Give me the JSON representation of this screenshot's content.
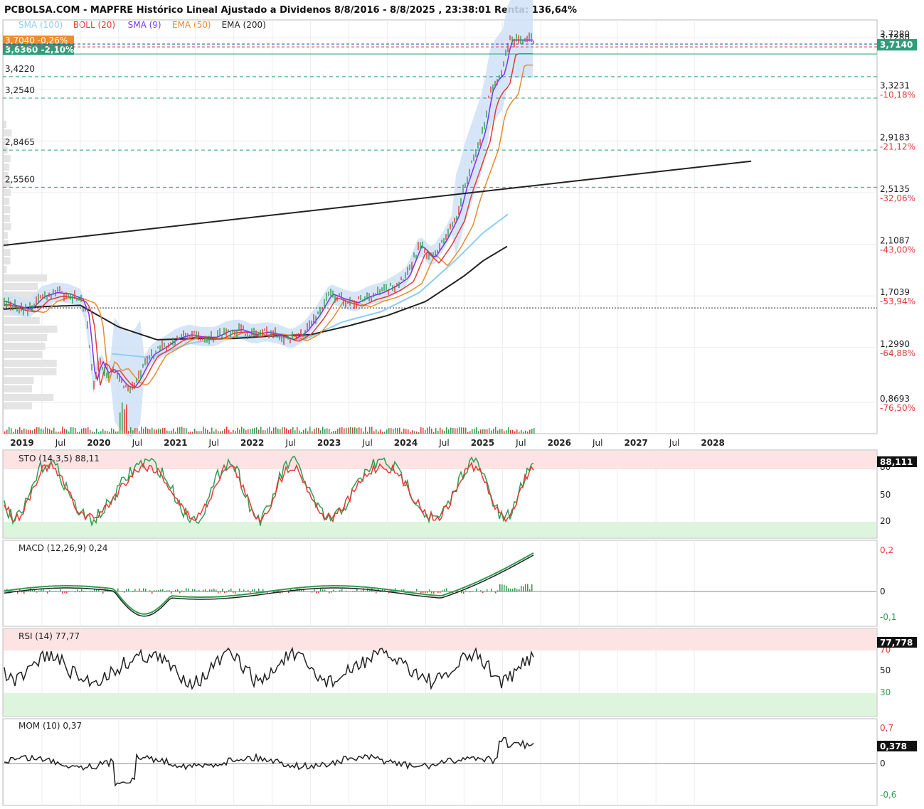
{
  "title": "PCBOLSA.COM - MAPFRE Histórico Lineal Ajustado a Dividenos 8/8/2016 - 8/8/2025 , 23:38:01 Renta: 136,64%",
  "legend": [
    {
      "label": "SMA (100)",
      "color": "#8ecdf0"
    },
    {
      "label": "BOLL (20)",
      "color": "#e53935"
    },
    {
      "label": "SMA (9)",
      "color": "#7b2ff7"
    },
    {
      "label": "EMA (50)",
      "color": "#e8892e"
    },
    {
      "label": "EMA (200)",
      "color": "#222222"
    }
  ],
  "price_tags": {
    "orange": "3,7040 -0,26%",
    "green": "3,6360 -2,10%",
    "last_price": "3,7140",
    "top_axis": "3,7280"
  },
  "colors": {
    "up": "#2e9d4f",
    "down": "#e53935",
    "band": "#cfe2f7",
    "tag_green": "#2e9d7a",
    "tag_orange": "#f28c28"
  },
  "chart_data": [
    {
      "type": "line",
      "panel": "price",
      "x_ticks": [
        "2019",
        "Jul",
        "2020",
        "Jul",
        "2021",
        "Jul",
        "2022",
        "Jul",
        "2023",
        "Jul",
        "2024",
        "Jul",
        "2025",
        "Jul",
        "2026",
        "Jul",
        "2027",
        "Jul",
        "2028"
      ],
      "bold_years": [
        "2019",
        "2020",
        "2021",
        "2022",
        "2023",
        "2024",
        "2025",
        "2026",
        "2027",
        "2028"
      ],
      "y_ticks": [
        {
          "value": 3.728,
          "label": "3,7280",
          "pct": ""
        },
        {
          "value": 3.3231,
          "label": "3,3231",
          "pct": "-10,18%"
        },
        {
          "value": 2.9183,
          "label": "2,9183",
          "pct": "-21,12%"
        },
        {
          "value": 2.5135,
          "label": "2,5135",
          "pct": "-32,06%"
        },
        {
          "value": 2.1087,
          "label": "2,1087",
          "pct": "-43,00%"
        },
        {
          "value": 1.7039,
          "label": "1,7039",
          "pct": "-53,94%"
        },
        {
          "value": 1.299,
          "label": "1,2990",
          "pct": "-64,88%"
        },
        {
          "value": 0.8693,
          "label": "0,8693",
          "pct": "-76,50%"
        }
      ],
      "levels": [
        {
          "value": 3.422,
          "label": "3,4220"
        },
        {
          "value": 3.254,
          "label": "3,2540"
        },
        {
          "value": 2.8465,
          "label": "2,8465"
        },
        {
          "value": 2.556,
          "label": "2,5560"
        }
      ],
      "support_line": 1.61,
      "trendline": [
        {
          "x": "2019-01",
          "y": 2.1
        },
        {
          "x": "2028-01",
          "y": 2.72
        }
      ],
      "series": [
        {
          "name": "Price",
          "color": "#2e9d4f",
          "x": [
            "2019-01",
            "2019-03",
            "2019-05",
            "2019-07",
            "2019-09",
            "2019-11",
            "2020-01",
            "2020-02",
            "2020-03",
            "2020-04",
            "2020-05",
            "2020-06",
            "2020-07",
            "2020-08",
            "2020-09",
            "2020-10",
            "2020-11",
            "2020-12",
            "2021-02",
            "2021-04",
            "2021-06",
            "2021-08",
            "2021-10",
            "2021-12",
            "2022-02",
            "2022-04",
            "2022-06",
            "2022-08",
            "2022-10",
            "2022-12",
            "2023-02",
            "2023-04",
            "2023-06",
            "2023-08",
            "2023-10",
            "2023-12",
            "2024-02",
            "2024-04",
            "2024-06",
            "2024-08",
            "2024-10",
            "2024-12",
            "2025-01",
            "2025-02",
            "2025-03",
            "2025-04",
            "2025-05",
            "2025-06",
            "2025-07",
            "2025-08"
          ],
          "y": [
            1.66,
            1.62,
            1.6,
            1.7,
            1.73,
            1.72,
            1.68,
            1.55,
            1.0,
            1.2,
            1.1,
            1.13,
            1.06,
            1.0,
            0.98,
            1.05,
            1.15,
            1.24,
            1.3,
            1.37,
            1.4,
            1.38,
            1.38,
            1.43,
            1.44,
            1.4,
            1.42,
            1.4,
            1.36,
            1.42,
            1.55,
            1.72,
            1.68,
            1.65,
            1.7,
            1.73,
            1.78,
            1.85,
            2.1,
            2.0,
            2.15,
            2.35,
            2.55,
            2.7,
            2.85,
            3.0,
            3.3,
            3.4,
            3.45,
            3.71
          ]
        },
        {
          "name": "EMA (200)",
          "color": "#222222",
          "x": [
            "2019-01",
            "2019-07",
            "2020-01",
            "2020-07",
            "2021-01",
            "2021-07",
            "2022-01",
            "2022-07",
            "2023-01",
            "2023-07",
            "2024-01",
            "2024-07",
            "2025-01",
            "2025-04",
            "2025-08"
          ],
          "y": [
            1.6,
            1.62,
            1.63,
            1.46,
            1.36,
            1.37,
            1.37,
            1.39,
            1.4,
            1.47,
            1.55,
            1.66,
            1.86,
            1.98,
            2.1
          ]
        },
        {
          "name": "SMA (100)",
          "color": "#8ecdf0",
          "x": [
            "2020-06",
            "2020-12",
            "2021-06",
            "2021-12",
            "2022-06",
            "2022-12",
            "2023-06",
            "2023-12",
            "2024-06",
            "2024-12",
            "2025-04",
            "2025-08"
          ],
          "y": [
            1.25,
            1.22,
            1.33,
            1.38,
            1.39,
            1.36,
            1.5,
            1.58,
            1.73,
            2.0,
            2.2,
            2.35
          ]
        }
      ]
    },
    {
      "type": "line",
      "panel": "STO",
      "label": "STO (14,3,5)",
      "value": "88,11",
      "last": "88,111",
      "y_ticks": [
        "80",
        "50",
        "20"
      ]
    },
    {
      "type": "line",
      "panel": "MACD",
      "label": "MACD (12,26,9)",
      "value": "0,24",
      "y_ticks": [
        "0,2",
        "0",
        "-0,1"
      ]
    },
    {
      "type": "line",
      "panel": "RSI",
      "label": "RSI (14)",
      "value": "77,77",
      "last": "77,778",
      "y_ticks": [
        "70",
        "50",
        "30"
      ]
    },
    {
      "type": "line",
      "panel": "MOM",
      "label": "MOM (10)",
      "value": "0,37",
      "last": "0,378",
      "y_ticks": [
        "0,7",
        "0",
        "-0,6"
      ]
    }
  ]
}
